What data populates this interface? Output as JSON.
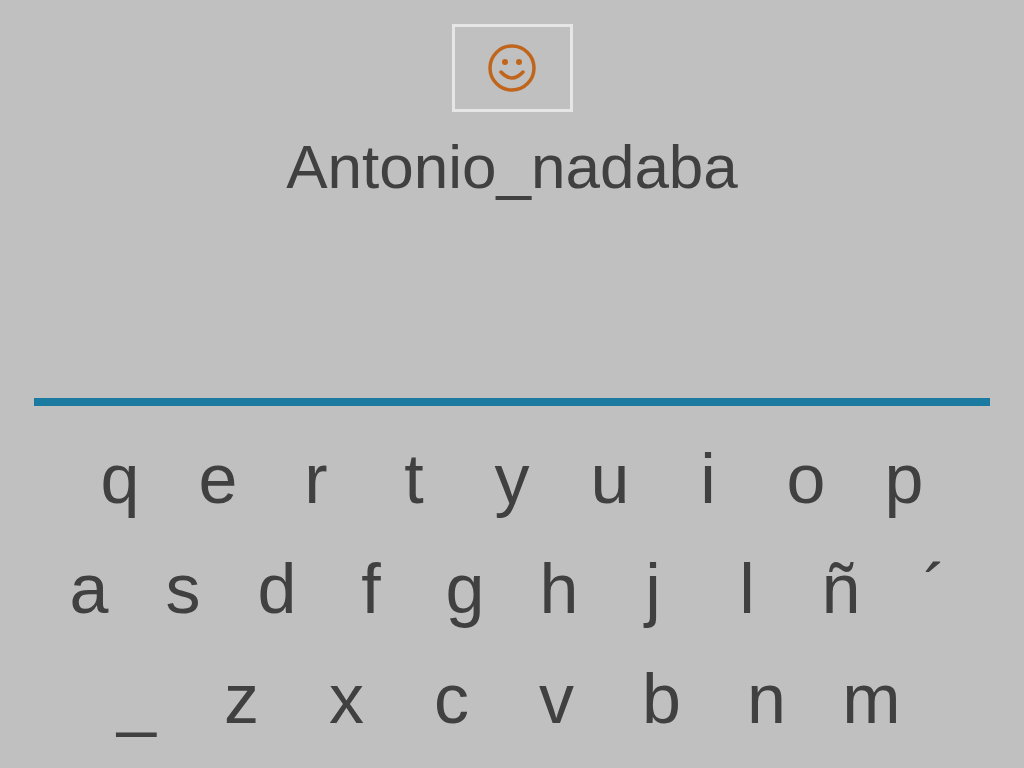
{
  "word": "Antonio_nadaba",
  "keyboard_rows": [
    [
      "q",
      "e",
      "r",
      "t",
      "y",
      "u",
      "i",
      "o",
      "p"
    ],
    [
      "a",
      "s",
      "d",
      "f",
      "g",
      "h",
      "j",
      "l",
      "ñ",
      "´"
    ],
    [
      "_",
      "z",
      "x",
      "c",
      "v",
      "b",
      "n",
      "m"
    ]
  ]
}
